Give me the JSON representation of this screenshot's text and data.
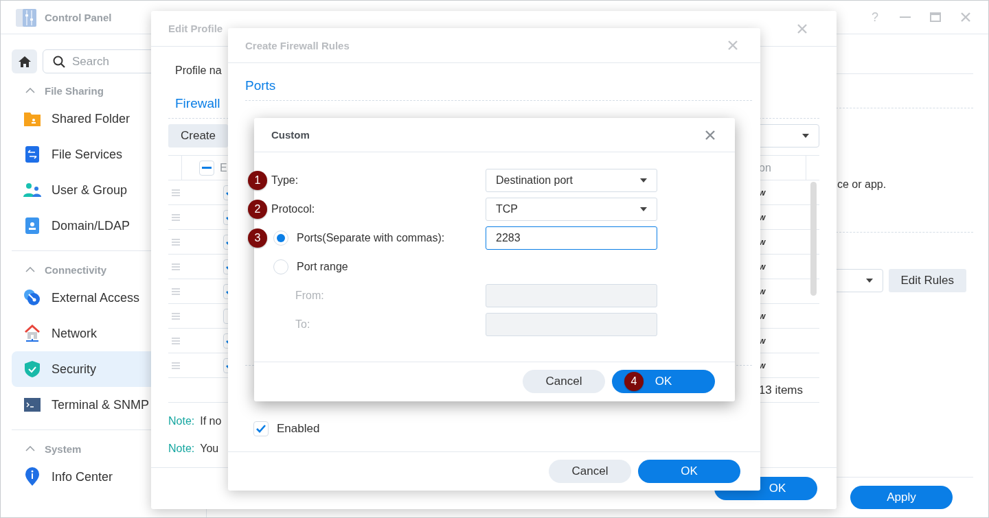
{
  "control_panel": {
    "title": "Control Panel",
    "help": "?",
    "search": {
      "placeholder": "Search"
    },
    "sidebar": [
      {
        "kind": "section",
        "label": "File Sharing",
        "expanded": true
      },
      {
        "kind": "item",
        "label": "Shared Folder",
        "selected": false
      },
      {
        "kind": "item",
        "label": "File Services",
        "selected": false
      },
      {
        "kind": "item",
        "label": "User & Group",
        "selected": false
      },
      {
        "kind": "item",
        "label": "Domain/LDAP",
        "selected": false
      },
      {
        "kind": "section",
        "label": "Connectivity",
        "expanded": true
      },
      {
        "kind": "item",
        "label": "External Access",
        "selected": false
      },
      {
        "kind": "item",
        "label": "Network",
        "selected": false
      },
      {
        "kind": "item",
        "label": "Security",
        "selected": true
      },
      {
        "kind": "item",
        "label": "Terminal & SNMP",
        "selected": false
      },
      {
        "kind": "section",
        "label": "System",
        "expanded": true
      },
      {
        "kind": "item",
        "label": "Info Center",
        "selected": false
      }
    ],
    "main": {
      "hint": "ce or app.",
      "edit_rules_button": "Edit Rules",
      "apply_button": "Apply"
    }
  },
  "edit_profile": {
    "title": "Edit Profile",
    "field_label": "Profile na",
    "section_title": "Firewall",
    "create_button": "Create",
    "column_1": "E",
    "column_last": "on",
    "header_checkbox_partial": true,
    "rows": [
      {
        "enabled": true,
        "column_last": "w"
      },
      {
        "enabled": true,
        "column_last": "w"
      },
      {
        "enabled": true,
        "column_last": "w"
      },
      {
        "enabled": true,
        "column_last": "w"
      },
      {
        "enabled": true,
        "column_last": "w"
      },
      {
        "enabled": false,
        "column_last": "w"
      },
      {
        "enabled": true,
        "column_last": "w"
      },
      {
        "enabled": true,
        "column_last": "w"
      }
    ],
    "item_count": "13 items",
    "notes": [
      {
        "label": "Note:",
        "text": "If no"
      },
      {
        "label": "Note:",
        "text": "You"
      }
    ],
    "ok_button": "OK"
  },
  "create_rules": {
    "title": "Create Firewall Rules",
    "section_title": "Ports",
    "enabled": {
      "label": "Enabled",
      "checked": true
    },
    "buttons": [
      {
        "label": "Cancel",
        "kind": "secondary"
      },
      {
        "label": "OK",
        "kind": "primary"
      }
    ]
  },
  "custom": {
    "title": "Custom",
    "fields": [
      {
        "kind": "select",
        "label": "Type:",
        "value": "Destination port",
        "badge": "1"
      },
      {
        "kind": "select",
        "label": "Protocol:",
        "value": "TCP",
        "badge": "2"
      },
      {
        "kind": "radio",
        "label": "Ports(Separate with commas):",
        "value": "2283",
        "selected": true,
        "badge": "3"
      },
      {
        "kind": "radio",
        "label": "Port range",
        "selected": false
      },
      {
        "kind": "input",
        "label": "From:",
        "disabled": true
      },
      {
        "kind": "input",
        "label": "To:",
        "disabled": true
      }
    ],
    "buttons": [
      {
        "label": "Cancel",
        "kind": "secondary"
      },
      {
        "label": "OK",
        "kind": "primary",
        "badge": "4"
      }
    ]
  }
}
